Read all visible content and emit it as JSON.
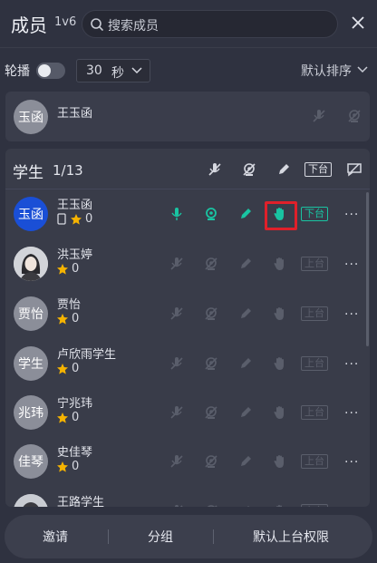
{
  "header": {
    "title": "成员",
    "count": "1v6",
    "search_placeholder": "搜索成员"
  },
  "controls": {
    "rotate_label": "轮播",
    "rotate_enabled": false,
    "seconds_value": "30",
    "seconds_unit": "秒",
    "sort_label": "默认排序"
  },
  "teacher": {
    "avatar_text": "玉函",
    "name": "王玉函"
  },
  "students": {
    "title": "学生",
    "count": "1/13",
    "header_badge": "下台",
    "rows": [
      {
        "avatar_text": "玉函",
        "name": "王玉函",
        "score": "0",
        "badge": "下台",
        "on_stage": true
      },
      {
        "avatar_text": "",
        "name": "洪玉婷",
        "score": "0",
        "badge": "上台",
        "on_stage": false
      },
      {
        "avatar_text": "贾怡",
        "name": "贾怡",
        "score": "0",
        "badge": "上台",
        "on_stage": false
      },
      {
        "avatar_text": "学生",
        "name": "卢欣雨学生",
        "score": "0",
        "badge": "上台",
        "on_stage": false
      },
      {
        "avatar_text": "兆玮",
        "name": "宁兆玮",
        "score": "0",
        "badge": "上台",
        "on_stage": false
      },
      {
        "avatar_text": "佳琴",
        "name": "史佳琴",
        "score": "0",
        "badge": "上台",
        "on_stage": false
      },
      {
        "avatar_text": "",
        "name": "王路学生",
        "score": "",
        "badge": "上台",
        "on_stage": false
      }
    ]
  },
  "footer": {
    "invite": "邀请",
    "group": "分组",
    "default_permission": "默认上台权限"
  },
  "colors": {
    "accent": "#19c4a2",
    "highlight": "#e0202a",
    "avatar_blue": "#1a4fd6"
  }
}
